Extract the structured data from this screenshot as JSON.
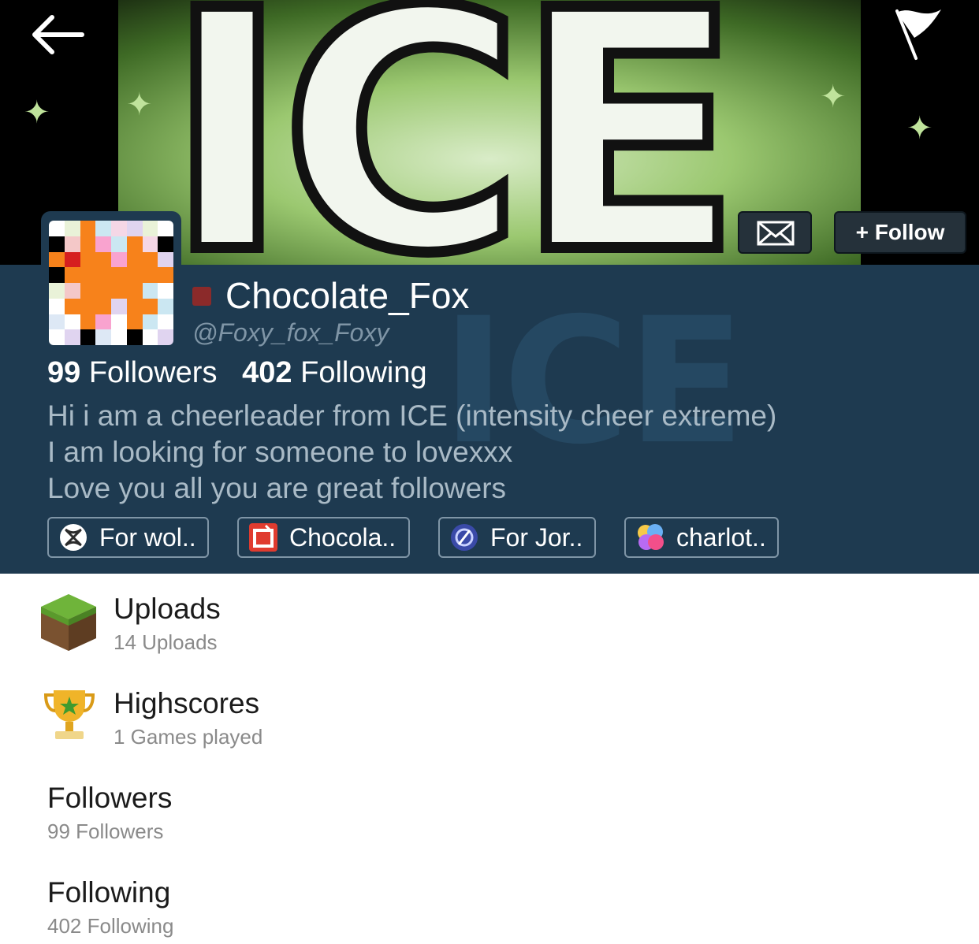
{
  "banner": {
    "text": "ICE"
  },
  "profile": {
    "display_name": "Chocolate_Fox",
    "handle": "@Foxy_fox_Foxy",
    "followers_count": "99",
    "followers_label": "Followers",
    "following_count": "402",
    "following_label": "Following",
    "bio": [
      "Hi i am a cheerleader from ICE (intensity cheer extreme)",
      "I am looking for someone to lovexxx",
      "Love you all you are great followers"
    ]
  },
  "actions": {
    "follow_label": "+ Follow"
  },
  "chips": [
    {
      "label": "For wol..",
      "icon": "xbox-icon"
    },
    {
      "label": "Chocola..",
      "icon": "game-app-icon"
    },
    {
      "label": "For Jor..",
      "icon": "playstation-network-icon"
    },
    {
      "label": "charlot..",
      "icon": "game-center-icon"
    }
  ],
  "list": [
    {
      "title": "Uploads",
      "subtitle": "14 Uploads",
      "icon": "grass-block-icon"
    },
    {
      "title": "Highscores",
      "subtitle": "1 Games played",
      "icon": "trophy-icon"
    },
    {
      "title": "Followers",
      "subtitle": "99 Followers"
    },
    {
      "title": "Following",
      "subtitle": "402 Following"
    }
  ],
  "colors": {
    "panel": "#1e3a50",
    "status": "#8b2a2a",
    "button": "#25313a"
  }
}
